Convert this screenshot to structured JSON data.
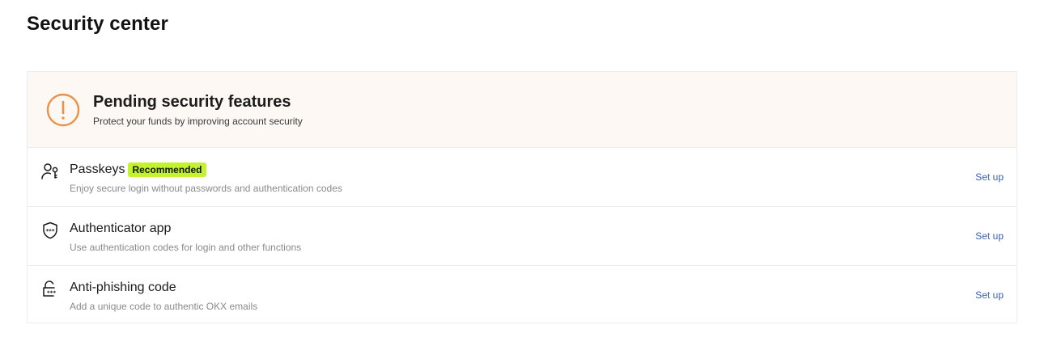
{
  "page": {
    "title": "Security center"
  },
  "banner": {
    "icon": "warning-circle-icon",
    "title": "Pending security features",
    "subtitle": "Protect your funds by improving account security",
    "accent_color": "#E8924A",
    "background": "#FDF8F3"
  },
  "features": [
    {
      "icon": "passkey-icon",
      "title": "Passkeys",
      "badge": "Recommended",
      "description": "Enjoy secure login without passwords and authentication codes",
      "action": "Set up"
    },
    {
      "icon": "authenticator-shield-icon",
      "title": "Authenticator app",
      "description": "Use authentication codes for login and other functions",
      "action": "Set up"
    },
    {
      "icon": "anti-phishing-lock-icon",
      "title": "Anti-phishing code",
      "description": "Add a unique code to authentic OKX emails",
      "action": "Set up"
    }
  ],
  "colors": {
    "badge_bg": "#C5F22E",
    "link": "#3A63B8"
  }
}
